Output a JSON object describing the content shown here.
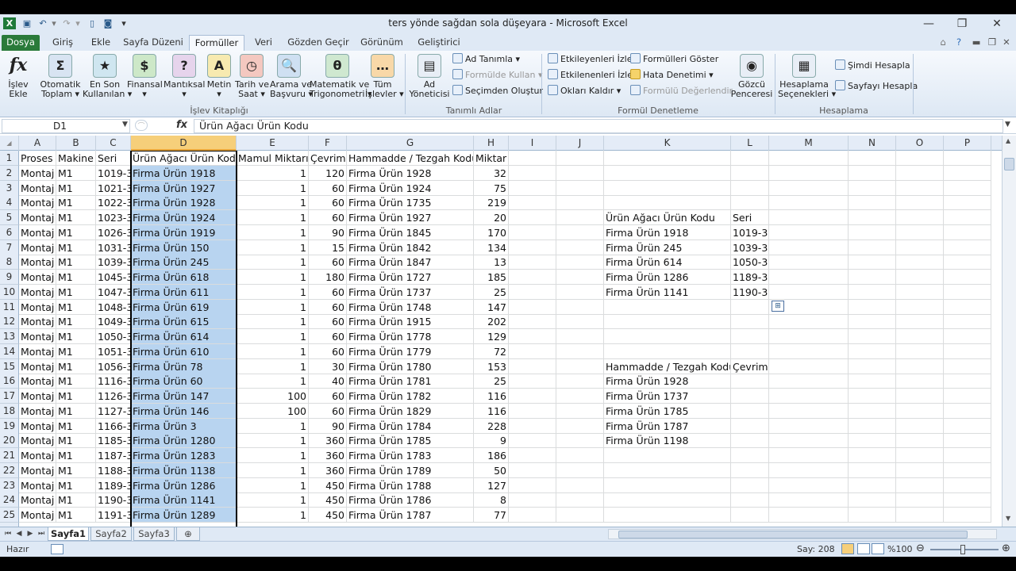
{
  "title_bar": {
    "title": "ters yönde sağdan sola düşeyara  -  Microsoft Excel",
    "minimize": "—",
    "restore": "❐",
    "close": "✕"
  },
  "ribbon_tabs": [
    "Dosya",
    "Giriş",
    "Ekle",
    "Sayfa Düzeni",
    "Formüller",
    "Veri",
    "Gözden Geçir",
    "Görünüm",
    "Geliştirici"
  ],
  "active_tab": "Formüller",
  "ribbon": {
    "insert_function": "İşlev\nEkle",
    "function_library": [
      {
        "label": "Otomatik\nToplam ▾",
        "icon": "Σ"
      },
      {
        "label": "En Son\nKullanılan ▾",
        "icon": "★"
      },
      {
        "label": "Finansal\n▾",
        "icon": "$"
      },
      {
        "label": "Mantıksal\n▾",
        "icon": "?"
      },
      {
        "label": "Metin\n▾",
        "icon": "A"
      },
      {
        "label": "Tarih ve\nSaat ▾",
        "icon": "◷"
      },
      {
        "label": "Arama ve\nBaşvuru ▾",
        "icon": "🔍"
      },
      {
        "label": "Matematik ve\nTrigonometri ▾",
        "icon": "θ"
      },
      {
        "label": "Tüm\nİşlevler ▾",
        "icon": "…"
      }
    ],
    "function_library_label": "İşlev Kitaplığı",
    "name_manager": "Ad\nYöneticisi",
    "define_name": "Ad Tanımla ▾",
    "use_in_formula": "Formülde Kullan ▾",
    "create_from_selection": "Seçimden Oluştur",
    "defined_names_label": "Tanımlı Adlar",
    "trace_precedents": "Etkileyenleri İzle",
    "trace_dependents": "Etkilenenleri İzle",
    "remove_arrows": "Okları Kaldır ▾",
    "show_formulas": "Formülleri Göster",
    "error_checking": "Hata Denetimi ▾",
    "evaluate_formula": "Formülü Değerlendir",
    "watch_window": "Gözcü\nPenceresi",
    "formula_auditing_label": "Formül Denetleme",
    "calc_options": "Hesaplama\nSeçenekleri ▾",
    "calc_now": "Şimdi Hesapla",
    "calc_sheet": "Sayfayı Hesapla",
    "calculation_label": "Hesaplama"
  },
  "formula_bar": {
    "name_box": "D1",
    "fx": "fx",
    "content": "Ürün Ağacı Ürün Kodu"
  },
  "columns": [
    "A",
    "B",
    "C",
    "D",
    "E",
    "F",
    "G",
    "H",
    "I",
    "J",
    "K",
    "L",
    "M",
    "N",
    "O",
    "P"
  ],
  "selected_column": "D",
  "rows": [
    {
      "n": "1",
      "A": "Proses",
      "B": "Makine",
      "C": "Seri",
      "D": "Ürün Ağacı Ürün Kodu",
      "E": "Mamul Miktarı",
      "F": "Çevrim",
      "G": "Hammadde / Tezgah Kodu",
      "H": "Miktar",
      "K": "",
      "L": ""
    },
    {
      "n": "2",
      "A": "Montaj",
      "B": "M1",
      "C": "1019-3",
      "D": "Firma Ürün 1918",
      "E": "1",
      "F": "120",
      "G": "Firma Ürün 1928",
      "H": "32",
      "K": "",
      "L": ""
    },
    {
      "n": "3",
      "A": "Montaj",
      "B": "M1",
      "C": "1021-3",
      "D": "Firma Ürün 1927",
      "E": "1",
      "F": "60",
      "G": "Firma Ürün 1924",
      "H": "75",
      "K": "",
      "L": ""
    },
    {
      "n": "4",
      "A": "Montaj",
      "B": "M1",
      "C": "1022-3",
      "D": "Firma Ürün 1928",
      "E": "1",
      "F": "60",
      "G": "Firma Ürün 1735",
      "H": "219",
      "K": "",
      "L": ""
    },
    {
      "n": "5",
      "A": "Montaj",
      "B": "M1",
      "C": "1023-3",
      "D": "Firma Ürün 1924",
      "E": "1",
      "F": "60",
      "G": "Firma Ürün 1927",
      "H": "20",
      "K": "Ürün Ağacı Ürün Kodu",
      "L": "Seri"
    },
    {
      "n": "6",
      "A": "Montaj",
      "B": "M1",
      "C": "1026-3",
      "D": "Firma Ürün 1919",
      "E": "1",
      "F": "90",
      "G": "Firma Ürün 1845",
      "H": "170",
      "K": "Firma Ürün 1918",
      "L": "1019-3"
    },
    {
      "n": "7",
      "A": "Montaj",
      "B": "M1",
      "C": "1031-3",
      "D": "Firma Ürün 150",
      "E": "1",
      "F": "15",
      "G": "Firma Ürün 1842",
      "H": "134",
      "K": "Firma Ürün 245",
      "L": "1039-3"
    },
    {
      "n": "8",
      "A": "Montaj",
      "B": "M1",
      "C": "1039-3",
      "D": "Firma Ürün 245",
      "E": "1",
      "F": "60",
      "G": "Firma Ürün 1847",
      "H": "13",
      "K": "Firma Ürün 614",
      "L": "1050-3"
    },
    {
      "n": "9",
      "A": "Montaj",
      "B": "M1",
      "C": "1045-3",
      "D": "Firma Ürün 618",
      "E": "1",
      "F": "180",
      "G": "Firma Ürün 1727",
      "H": "185",
      "K": "Firma Ürün 1286",
      "L": "1189-3"
    },
    {
      "n": "10",
      "A": "Montaj",
      "B": "M1",
      "C": "1047-3",
      "D": "Firma Ürün 611",
      "E": "1",
      "F": "60",
      "G": "Firma Ürün 1737",
      "H": "25",
      "K": "Firma Ürün 1141",
      "L": "1190-3"
    },
    {
      "n": "11",
      "A": "Montaj",
      "B": "M1",
      "C": "1048-3",
      "D": "Firma Ürün 619",
      "E": "1",
      "F": "60",
      "G": "Firma Ürün 1748",
      "H": "147",
      "K": "",
      "L": ""
    },
    {
      "n": "12",
      "A": "Montaj",
      "B": "M1",
      "C": "1049-3",
      "D": "Firma Ürün 615",
      "E": "1",
      "F": "60",
      "G": "Firma Ürün 1915",
      "H": "202",
      "K": "",
      "L": ""
    },
    {
      "n": "13",
      "A": "Montaj",
      "B": "M1",
      "C": "1050-3",
      "D": "Firma Ürün 614",
      "E": "1",
      "F": "60",
      "G": "Firma Ürün 1778",
      "H": "129",
      "K": "",
      "L": ""
    },
    {
      "n": "14",
      "A": "Montaj",
      "B": "M1",
      "C": "1051-3",
      "D": "Firma Ürün 610",
      "E": "1",
      "F": "60",
      "G": "Firma Ürün 1779",
      "H": "72",
      "K": "",
      "L": ""
    },
    {
      "n": "15",
      "A": "Montaj",
      "B": "M1",
      "C": "1056-3",
      "D": "Firma Ürün 78",
      "E": "1",
      "F": "30",
      "G": "Firma Ürün 1780",
      "H": "153",
      "K": "Hammadde / Tezgah Kodu",
      "L": "Çevrim"
    },
    {
      "n": "16",
      "A": "Montaj",
      "B": "M1",
      "C": "1116-3",
      "D": "Firma Ürün 60",
      "E": "1",
      "F": "40",
      "G": "Firma Ürün 1781",
      "H": "25",
      "K": "Firma Ürün 1928",
      "L": ""
    },
    {
      "n": "17",
      "A": "Montaj",
      "B": "M1",
      "C": "1126-3",
      "D": "Firma Ürün 147",
      "E": "100",
      "F": "60",
      "G": "Firma Ürün 1782",
      "H": "116",
      "K": "Firma Ürün 1737",
      "L": ""
    },
    {
      "n": "18",
      "A": "Montaj",
      "B": "M1",
      "C": "1127-3",
      "D": "Firma Ürün 146",
      "E": "100",
      "F": "60",
      "G": "Firma Ürün 1829",
      "H": "116",
      "K": "Firma Ürün 1785",
      "L": ""
    },
    {
      "n": "19",
      "A": "Montaj",
      "B": "M1",
      "C": "1166-3",
      "D": "Firma Ürün 3",
      "E": "1",
      "F": "90",
      "G": "Firma Ürün 1784",
      "H": "228",
      "K": "Firma Ürün 1787",
      "L": ""
    },
    {
      "n": "20",
      "A": "Montaj",
      "B": "M1",
      "C": "1185-3",
      "D": "Firma Ürün 1280",
      "E": "1",
      "F": "360",
      "G": "Firma Ürün 1785",
      "H": "9",
      "K": "Firma Ürün 1198",
      "L": ""
    },
    {
      "n": "21",
      "A": "Montaj",
      "B": "M1",
      "C": "1187-3",
      "D": "Firma Ürün 1283",
      "E": "1",
      "F": "360",
      "G": "Firma Ürün 1783",
      "H": "186",
      "K": "",
      "L": ""
    },
    {
      "n": "22",
      "A": "Montaj",
      "B": "M1",
      "C": "1188-3",
      "D": "Firma Ürün 1138",
      "E": "1",
      "F": "360",
      "G": "Firma Ürün 1789",
      "H": "50",
      "K": "",
      "L": ""
    },
    {
      "n": "23",
      "A": "Montaj",
      "B": "M1",
      "C": "1189-3",
      "D": "Firma Ürün 1286",
      "E": "1",
      "F": "450",
      "G": "Firma Ürün 1788",
      "H": "127",
      "K": "",
      "L": ""
    },
    {
      "n": "24",
      "A": "Montaj",
      "B": "M1",
      "C": "1190-3",
      "D": "Firma Ürün 1141",
      "E": "1",
      "F": "450",
      "G": "Firma Ürün 1786",
      "H": "8",
      "K": "",
      "L": ""
    },
    {
      "n": "25",
      "A": "Montaj",
      "B": "M1",
      "C": "1191-3",
      "D": "Firma Ürün 1289",
      "E": "1",
      "F": "450",
      "G": "Firma Ürün 1787",
      "H": "77",
      "K": "",
      "L": ""
    }
  ],
  "sheet_tabs": [
    "Sayfa1",
    "Sayfa2",
    "Sayfa3"
  ],
  "active_sheet": "Sayfa1",
  "status": {
    "ready": "Hazır",
    "count": "Say: 208",
    "zoom": "%100"
  },
  "colors": {
    "file_tab": "#2a7a3a",
    "selection": "#b8d4f0",
    "selected_header": "#f6cf7a"
  }
}
